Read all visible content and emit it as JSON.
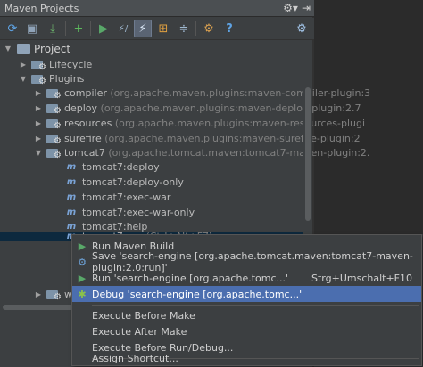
{
  "window": {
    "title": "Maven Projects"
  },
  "toolbar": {
    "buttons": [
      "reimport-icon",
      "generate-sources-icon",
      "download-icon",
      "add-icon",
      "run-icon",
      "toggle-offline-icon",
      "skip-tests-icon",
      "diagram-icon",
      "collapse-icon",
      "settings-icon",
      "help-icon"
    ]
  },
  "tree": {
    "project": "Project",
    "lifecycle": "Lifecycle",
    "plugins": "Plugins",
    "plugin_items": [
      {
        "name": "compiler",
        "detail": "(org.apache.maven.plugins:maven-compiler-plugin:3"
      },
      {
        "name": "deploy",
        "detail": "(org.apache.maven.plugins:maven-deploy-plugin:2.7"
      },
      {
        "name": "resources",
        "detail": "(org.apache.maven.plugins:maven-resources-plugi"
      },
      {
        "name": "surefire",
        "detail": "(org.apache.maven.plugins:maven-surefire-plugin:2"
      },
      {
        "name": "tomcat7",
        "detail": "(org.apache.tomcat.maven:tomcat7-maven-plugin:2."
      }
    ],
    "goals": [
      "tomcat7:deploy",
      "tomcat7:deploy-only",
      "tomcat7:exec-war",
      "tomcat7:exec-war-only",
      "tomcat7:help",
      "tomcat7:run"
    ],
    "run_shortcut": "(Ctrl+Alt+F7)",
    "partial_w": "w"
  },
  "context_menu": {
    "run_maven_build": "Run Maven Build",
    "save": "Save 'search-engine [org.apache.tomcat.maven:tomcat7-maven-plugin:2.0:run]'",
    "run": "Run 'search-engine [org.apache.tomc...'",
    "run_shortcut": "Strg+Umschalt+F10",
    "debug": "Debug 'search-engine [org.apache.tomc...'",
    "execute_before_make": "Execute Before Make",
    "execute_after_make": "Execute After Make",
    "execute_before_run": "Execute Before Run/Debug...",
    "assign_shortcut": "Assign Shortcut..."
  }
}
